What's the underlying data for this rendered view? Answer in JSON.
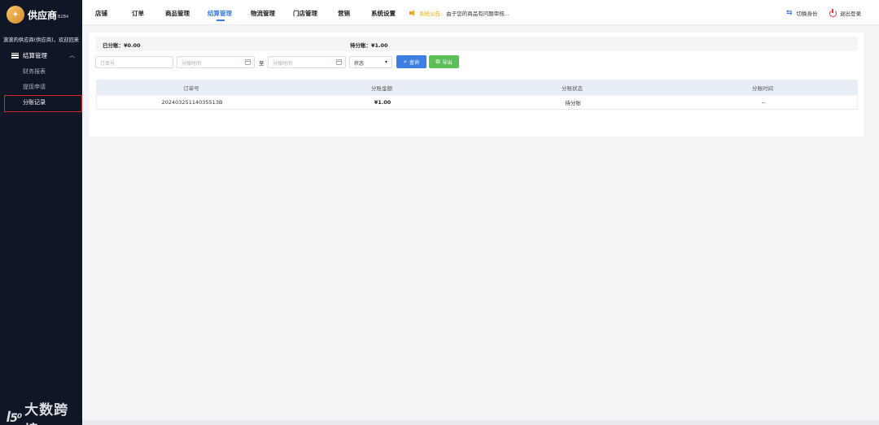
{
  "sidebar": {
    "logo_text": "供应商",
    "logo_sub": "B2B4",
    "welcome": "滚滚的供应商(供应商)，欢迎回来",
    "group_label": "结算管理",
    "items": [
      {
        "label": "财务报表"
      },
      {
        "label": "提现申请"
      },
      {
        "label": "分账记录"
      }
    ],
    "watermark_text": "大数跨境",
    "watermark_icon": "l50-logo"
  },
  "topnav": {
    "items": [
      {
        "label": "店铺"
      },
      {
        "label": "订单"
      },
      {
        "label": "商品管理"
      },
      {
        "label": "结算管理"
      },
      {
        "label": "物流管理"
      },
      {
        "label": "门店管理"
      },
      {
        "label": "营销"
      },
      {
        "label": "系统设置"
      }
    ],
    "active_index": 3,
    "notice_label": "系统公告:",
    "notice_text": "由于您的商品有问题审核...",
    "switch_label": "切换身份",
    "logout_label": "退出登录",
    "accent_color": "#3f7ed8"
  },
  "summary": {
    "settled": "已分账：¥0.00",
    "pending": "待分账：¥1.00"
  },
  "filters": {
    "order_placeholder": "订单号",
    "date_start_placeholder": "分账时间",
    "date_sep": "至",
    "date_end_placeholder": "分账时间",
    "status_label": "状态",
    "search_label": "查询",
    "export_label": "导出"
  },
  "table": {
    "headers": [
      "订单号",
      "分账金额",
      "分账状态",
      "分账时间"
    ],
    "rows": [
      [
        "20240325114035513B",
        "¥1.00",
        "待分账",
        "--"
      ]
    ]
  }
}
